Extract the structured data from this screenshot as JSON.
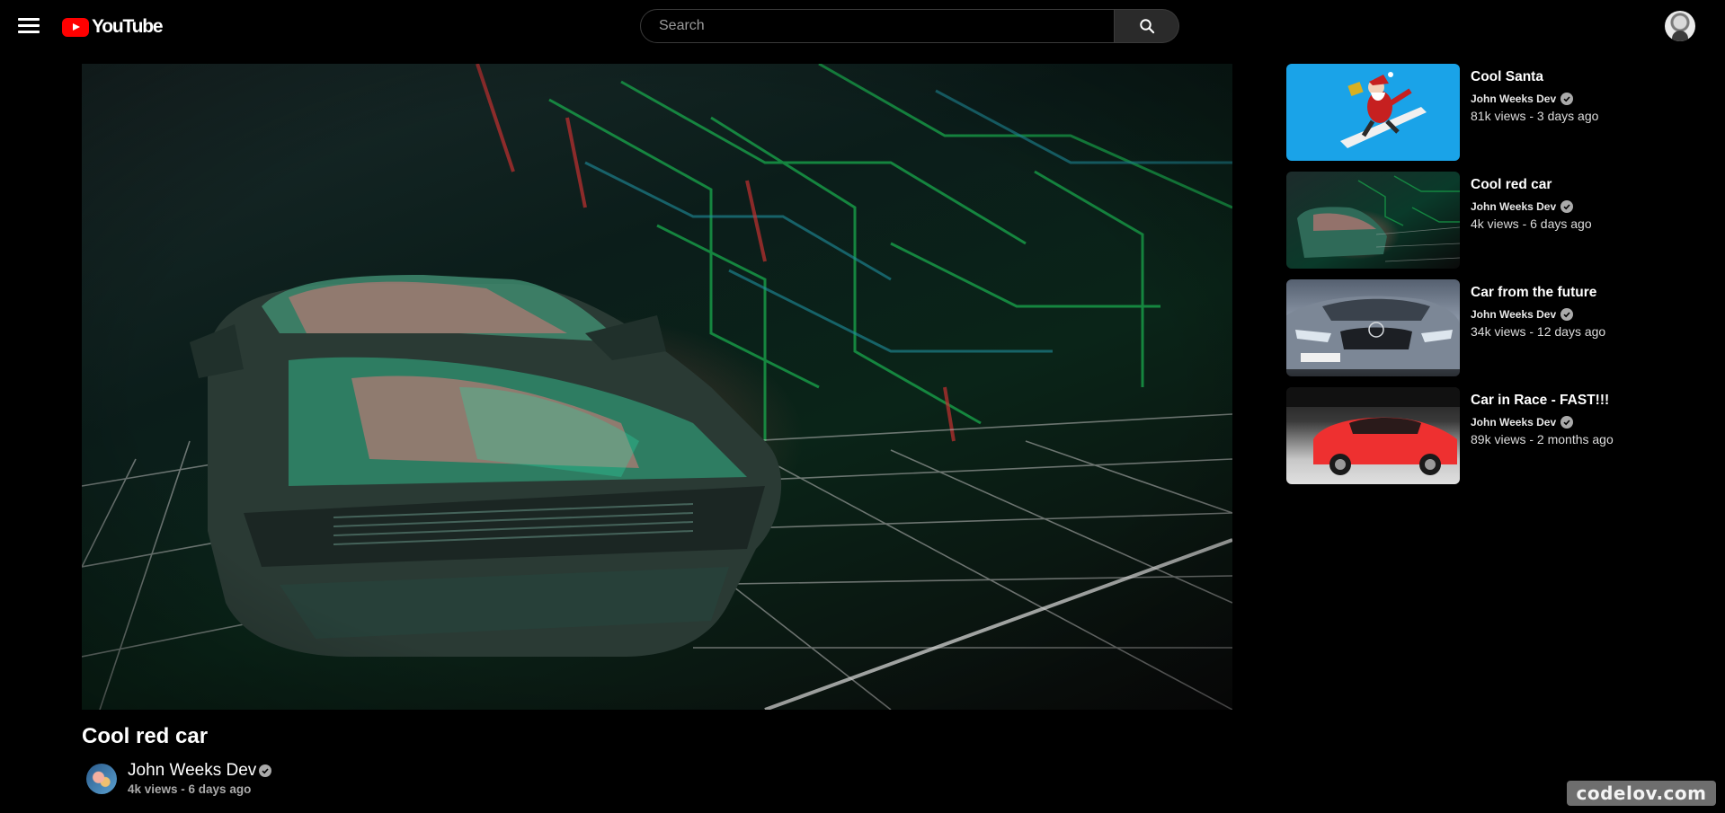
{
  "header": {
    "logo_text": "YouTube",
    "search": {
      "placeholder": "Search",
      "value": ""
    },
    "icons": {
      "menu": "menu-icon",
      "search": "search-icon",
      "avatar": "user-avatar"
    }
  },
  "video": {
    "title": "Cool red car",
    "channel": "John Weeks Dev",
    "stats": "4k views - 6 days ago"
  },
  "recommendations": [
    {
      "title": "Cool Santa",
      "channel": "John Weeks Dev",
      "stats": "81k views - 3 days ago"
    },
    {
      "title": "Cool red car",
      "channel": "John Weeks Dev",
      "stats": "4k views - 6 days ago"
    },
    {
      "title": "Car from the future",
      "channel": "John Weeks Dev",
      "stats": "34k views - 12 days ago"
    },
    {
      "title": "Car in Race - FAST!!!",
      "channel": "John Weeks Dev",
      "stats": "89k views - 2 months ago"
    }
  ],
  "watermark": "codelov.com",
  "colors": {
    "background": "#000000",
    "brand_red": "#ff0000",
    "muted_text": "#aaaaaa",
    "search_button": "#2a2a2a"
  }
}
